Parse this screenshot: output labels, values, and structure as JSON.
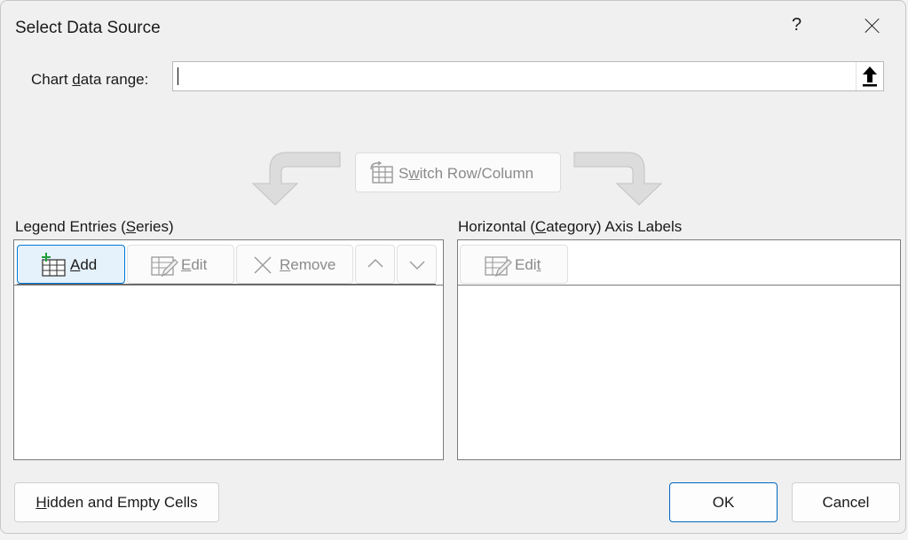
{
  "dialog": {
    "title": "Select Data Source",
    "help": "?"
  },
  "range": {
    "label_pre": "Chart ",
    "label_key": "d",
    "label_post": "ata range:",
    "value": ""
  },
  "switch": {
    "label_pre": "S",
    "label_key": "w",
    "label_post": "itch Row/Column"
  },
  "legend": {
    "label_pre": "Legend Entries (",
    "label_key": "S",
    "label_post": "eries)",
    "add": {
      "key": "A",
      "rest": "dd"
    },
    "edit": {
      "key": "E",
      "rest": "dit"
    },
    "remove": {
      "key": "R",
      "rest": "emove"
    }
  },
  "axis": {
    "label_pre": "Horizontal (",
    "label_key": "C",
    "label_post": "ategory) Axis Labels",
    "edit": {
      "pre": "Edi",
      "key": "t"
    }
  },
  "footer": {
    "hidden": {
      "key": "H",
      "rest": "idden and Empty Cells"
    },
    "ok": "OK",
    "cancel": "Cancel"
  },
  "colors": {
    "accent": "#0078d4",
    "disabled_text": "#8a8a8a"
  }
}
